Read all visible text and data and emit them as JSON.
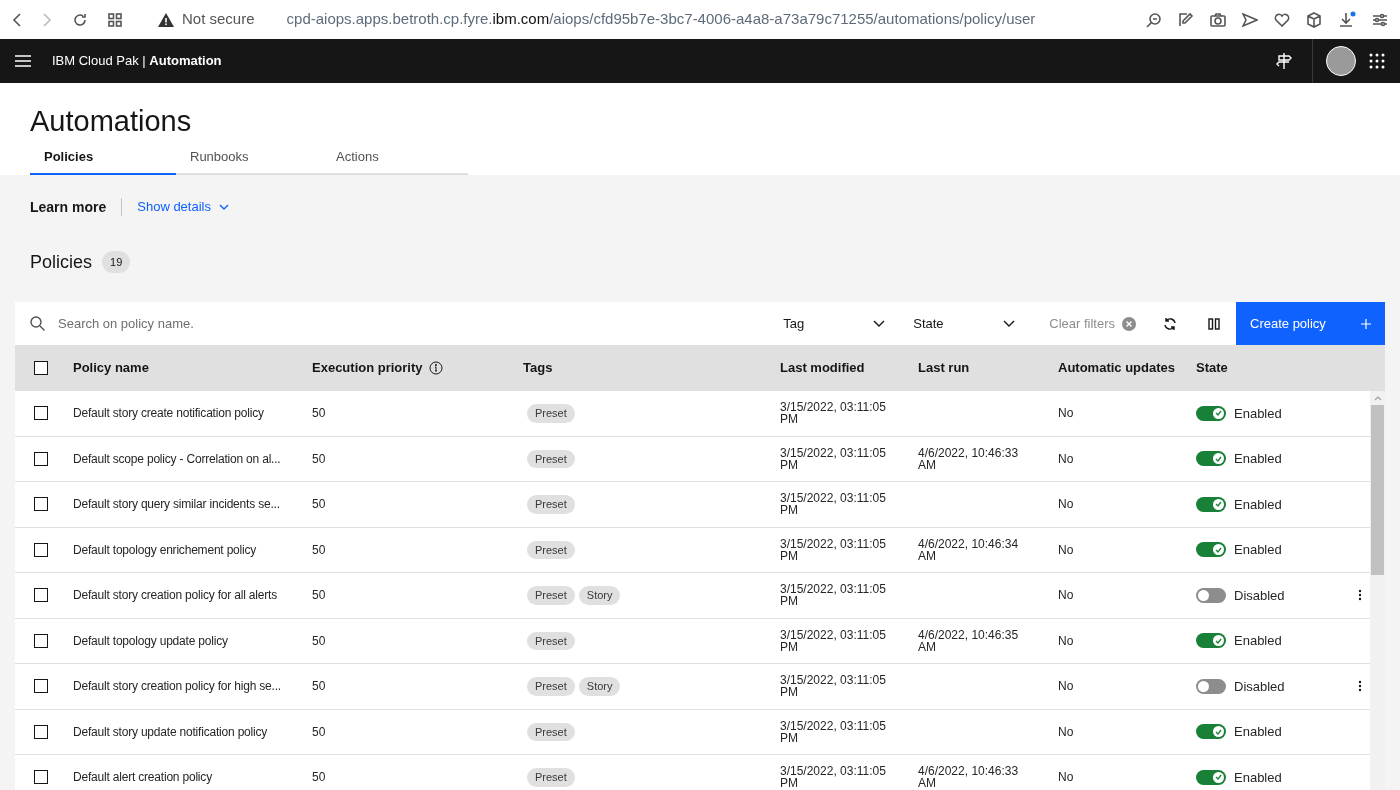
{
  "browser": {
    "security": "Not secure",
    "url_host_prefix": "cpd-aiops.apps.betroth.cp.fyre.",
    "url_domain": "ibm.com",
    "url_path": "/aiops/cfd95b7e-3bc7-4006-a4a8-a73a79c71255/automations/policy/user"
  },
  "header": {
    "product": "IBM Cloud Pak",
    "separator": "|",
    "section": "Automation"
  },
  "page": {
    "title": "Automations"
  },
  "tabs": [
    {
      "label": "Policies",
      "selected": true
    },
    {
      "label": "Runbooks",
      "selected": false
    },
    {
      "label": "Actions",
      "selected": false
    }
  ],
  "learn_more": {
    "label": "Learn more",
    "link": "Show details"
  },
  "policies": {
    "title": "Policies",
    "count": "19"
  },
  "toolbar": {
    "search_placeholder": "Search on policy name.",
    "filters": [
      "Tag",
      "State"
    ],
    "clear_filters": "Clear filters",
    "create_button": "Create policy"
  },
  "table": {
    "select_all_checked": false,
    "columns": [
      "Policy name",
      "Execution priority",
      "Tags",
      "Last modified",
      "Last run",
      "Automatic updates",
      "State"
    ],
    "rows": [
      {
        "checked": false,
        "name": "Default story create notification policy",
        "priority": "50",
        "tags": [
          "Preset"
        ],
        "last_modified": "3/15/2022, 03:11:05 PM",
        "last_run": "",
        "auto_updates": "No",
        "enabled": true,
        "state": "Enabled",
        "overflow_menu": false
      },
      {
        "checked": false,
        "name": "Default scope policy - Correlation on al...",
        "priority": "50",
        "tags": [
          "Preset"
        ],
        "last_modified": "3/15/2022, 03:11:05 PM",
        "last_run": "4/6/2022, 10:46:33 AM",
        "auto_updates": "No",
        "enabled": true,
        "state": "Enabled",
        "overflow_menu": false
      },
      {
        "checked": false,
        "name": "Default story query similar incidents se...",
        "priority": "50",
        "tags": [
          "Preset"
        ],
        "last_modified": "3/15/2022, 03:11:05 PM",
        "last_run": "",
        "auto_updates": "No",
        "enabled": true,
        "state": "Enabled",
        "overflow_menu": false
      },
      {
        "checked": false,
        "name": "Default topology enrichement policy",
        "priority": "50",
        "tags": [
          "Preset"
        ],
        "last_modified": "3/15/2022, 03:11:05 PM",
        "last_run": "4/6/2022, 10:46:34 AM",
        "auto_updates": "No",
        "enabled": true,
        "state": "Enabled",
        "overflow_menu": false
      },
      {
        "checked": false,
        "name": "Default story creation policy for all alerts",
        "priority": "50",
        "tags": [
          "Preset",
          "Story"
        ],
        "last_modified": "3/15/2022, 03:11:05 PM",
        "last_run": "",
        "auto_updates": "No",
        "enabled": false,
        "state": "Disabled",
        "overflow_menu": true
      },
      {
        "checked": false,
        "name": "Default topology update policy",
        "priority": "50",
        "tags": [
          "Preset"
        ],
        "last_modified": "3/15/2022, 03:11:05 PM",
        "last_run": "4/6/2022, 10:46:35 AM",
        "auto_updates": "No",
        "enabled": true,
        "state": "Enabled",
        "overflow_menu": false
      },
      {
        "checked": false,
        "name": "Default story creation policy for high se...",
        "priority": "50",
        "tags": [
          "Preset",
          "Story"
        ],
        "last_modified": "3/15/2022, 03:11:05 PM",
        "last_run": "",
        "auto_updates": "No",
        "enabled": false,
        "state": "Disabled",
        "overflow_menu": true
      },
      {
        "checked": false,
        "name": "Default story update notification policy",
        "priority": "50",
        "tags": [
          "Preset"
        ],
        "last_modified": "3/15/2022, 03:11:05 PM",
        "last_run": "",
        "auto_updates": "No",
        "enabled": true,
        "state": "Enabled",
        "overflow_menu": false
      },
      {
        "checked": false,
        "name": "Default alert creation policy",
        "priority": "50",
        "tags": [
          "Preset"
        ],
        "last_modified": "3/15/2022, 03:11:05 PM",
        "last_run": "4/6/2022, 10:46:33 AM",
        "auto_updates": "No",
        "enabled": true,
        "state": "Enabled",
        "overflow_menu": false
      }
    ]
  }
}
